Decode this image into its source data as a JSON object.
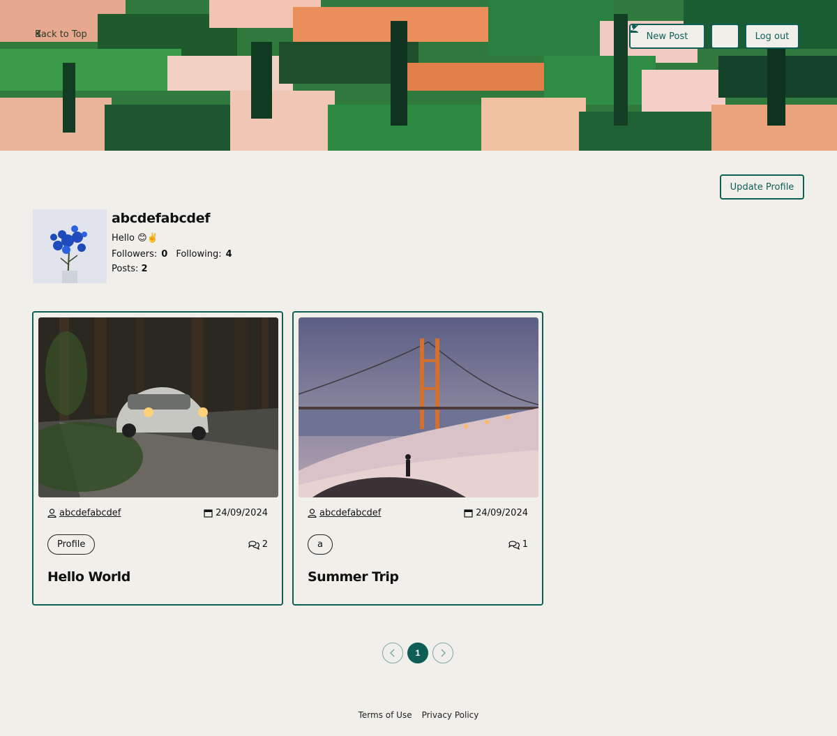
{
  "nav": {
    "back_label": "Back to Top",
    "new_post_label": "New Post",
    "logout_label": "Log out"
  },
  "profile": {
    "update_label": "Update Profile",
    "username": "abcdefabcdef",
    "bio": "Hello 😊✌️",
    "followers_label": "Followers:",
    "followers_count": "0",
    "following_label": "Following:",
    "following_count": "4",
    "posts_label": "Posts:",
    "posts_count": "2"
  },
  "posts": [
    {
      "author": "abcdefabcdef",
      "date": "24/09/2024",
      "tag": "Profile",
      "comments": "2",
      "title": "Hello World"
    },
    {
      "author": "abcdefabcdef",
      "date": "24/09/2024",
      "tag": "a",
      "comments": "1",
      "title": "Summer Trip"
    }
  ],
  "pagination": {
    "current_page": "1"
  },
  "footer": {
    "terms_label": "Terms of Use",
    "privacy_label": "Privacy Policy"
  },
  "theme": {
    "accent": "#0e5e56",
    "background": "#f1efe9"
  }
}
